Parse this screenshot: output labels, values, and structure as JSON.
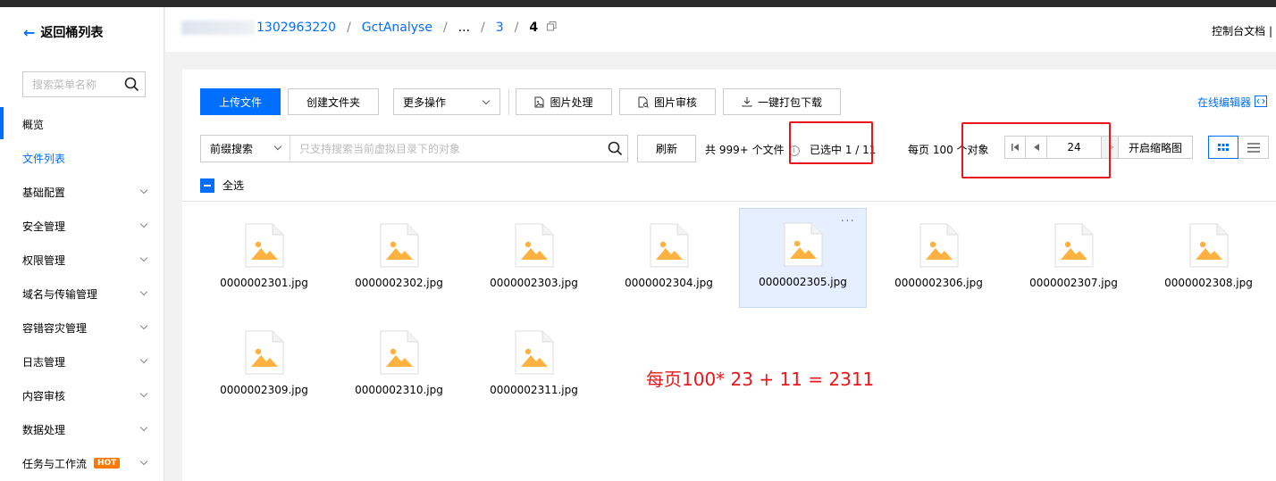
{
  "sidebar": {
    "back_label": "返回桶列表",
    "search_placeholder": "搜索菜单名称",
    "items": [
      {
        "label": "概览"
      },
      {
        "label": "文件列表"
      },
      {
        "label": "基础配置"
      },
      {
        "label": "安全管理"
      },
      {
        "label": "权限管理"
      },
      {
        "label": "域名与传输管理"
      },
      {
        "label": "容错容灾管理"
      },
      {
        "label": "日志管理"
      },
      {
        "label": "内容审核"
      },
      {
        "label": "数据处理"
      },
      {
        "label": "任务与工作流",
        "badge": "HOT"
      }
    ],
    "active_item": "文件列表"
  },
  "header": {
    "bucket_partial": "1302963220",
    "crumbs": [
      "GctAnalyse",
      "...",
      "3",
      "4"
    ],
    "console_doc": "控制台文档"
  },
  "toolbar": {
    "upload": "上传文件",
    "create_folder": "创建文件夹",
    "more_actions": "更多操作",
    "image_process": "图片处理",
    "image_audit": "图片审核",
    "pack_download": "一键打包下载",
    "online_editor": "在线编辑器"
  },
  "search": {
    "prefix": "前缀搜索",
    "placeholder": "只支持搜索当前虚拟目录下的对象",
    "refresh": "刷新"
  },
  "stats": {
    "total_files": "共 999+ 个文件",
    "selected": "已选中 1 / 11",
    "per_page": "每页 100 个对象"
  },
  "pager": {
    "page": "24"
  },
  "thumbnail_btn": "开启缩略图",
  "select_all": "全选",
  "files": [
    "0000002301.jpg",
    "0000002302.jpg",
    "0000002303.jpg",
    "0000002304.jpg",
    "0000002305.jpg",
    "0000002306.jpg",
    "0000002307.jpg",
    "0000002308.jpg",
    "0000002309.jpg",
    "0000002310.jpg",
    "0000002311.jpg"
  ],
  "selected_file": "0000002305.jpg",
  "more_glyph": "···",
  "annotation": "每页100* 23 + 11 = 2311",
  "colors": {
    "accent": "#006eff",
    "annotation_red": "#e8161b",
    "image_icon": "#ffb23f",
    "hot_badge": "#ff7800"
  }
}
